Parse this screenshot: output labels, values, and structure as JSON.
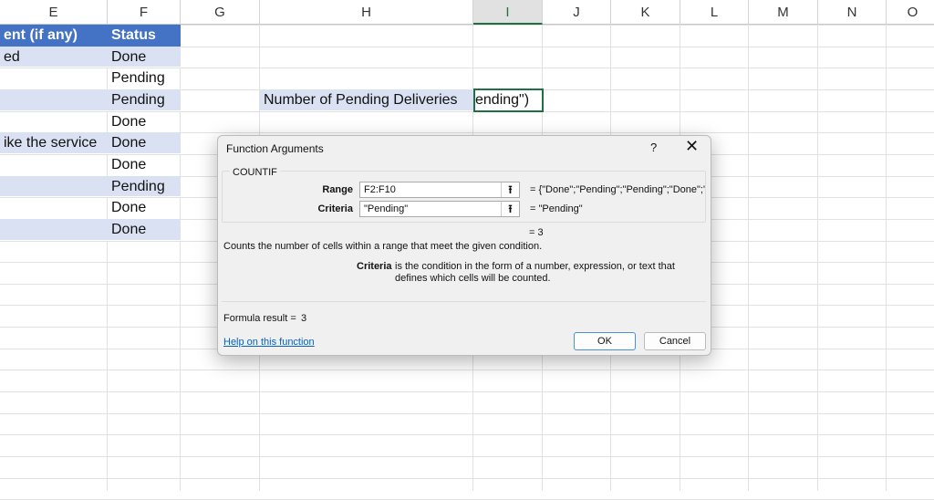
{
  "columns": [
    "E",
    "F",
    "G",
    "H",
    "I",
    "J",
    "K",
    "L",
    "M",
    "N",
    "O"
  ],
  "selected_column": "I",
  "cells": {
    "e_header": "ent (if any)",
    "f_header": "Status",
    "e_rows": [
      "ed",
      "",
      "",
      "",
      "ike the service",
      "",
      "",
      "",
      ""
    ],
    "f_rows": [
      "Done",
      "Pending",
      "Pending",
      "Done",
      "Done",
      "Done",
      "Pending",
      "Done",
      "Done"
    ],
    "h4": "Number of Pending Deliveries",
    "i4": "ending\")"
  },
  "colors": {
    "header_fill": "#4472c4",
    "band_fill": "#d9e1f2",
    "active_border": "#1e7145"
  },
  "dialog": {
    "title": "Function Arguments",
    "help_glyph": "?",
    "close_glyph": "✕",
    "function_name": "COUNTIF",
    "args": [
      {
        "label": "Range",
        "value": "F2:F10",
        "result": "= {\"Done\";\"Pending\";\"Pending\";\"Done\";\""
      },
      {
        "label": "Criteria",
        "value": "\"Pending\"",
        "result": "= \"Pending\""
      }
    ],
    "collapse_glyph": "⭱",
    "result_line": "= 3",
    "description": "Counts the number of cells within a range that meet the given condition.",
    "arg_help_name": "Criteria",
    "arg_help_text": "is the condition in the form of a number, expression, or text that defines which cells will be counted.",
    "formula_result_label": "Formula result =",
    "formula_result_value": "3",
    "help_link": "Help on this function",
    "ok": "OK",
    "cancel": "Cancel"
  }
}
